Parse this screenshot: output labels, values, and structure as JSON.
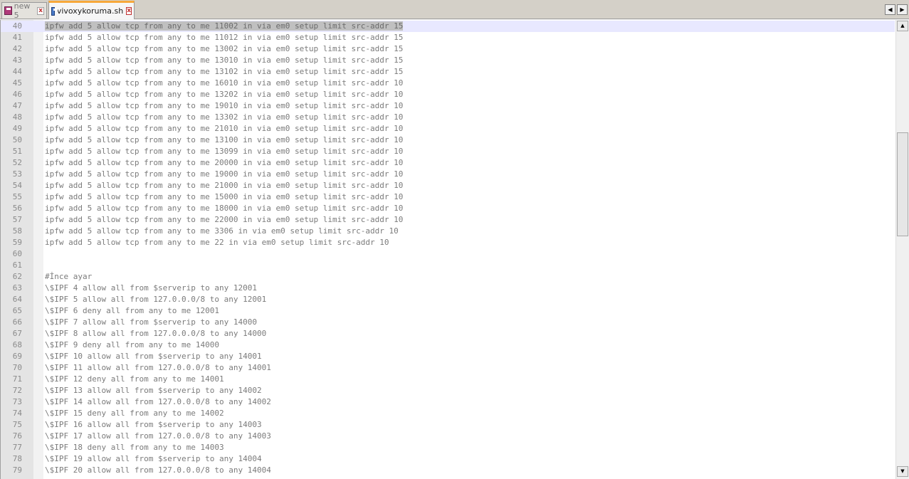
{
  "tabs": [
    {
      "label": "new 5",
      "state": "inactive",
      "icon": "unsaved-file-icon"
    },
    {
      "label": "vivoxykoruma.sh",
      "state": "active",
      "icon": "saved-file-icon"
    }
  ],
  "tab_nav": {
    "left": "◀",
    "right": "▶"
  },
  "scrollbar": {
    "up": "▲",
    "down": "▼"
  },
  "editor": {
    "current_line": 40,
    "lines": [
      {
        "n": "40",
        "text": "ipfw add 5 allow tcp from any to me 11002 in via em0 setup limit src-addr 15"
      },
      {
        "n": "41",
        "text": "ipfw add 5 allow tcp from any to me 11012 in via em0 setup limit src-addr 15"
      },
      {
        "n": "42",
        "text": "ipfw add 5 allow tcp from any to me 13002 in via em0 setup limit src-addr 15"
      },
      {
        "n": "43",
        "text": "ipfw add 5 allow tcp from any to me 13010 in via em0 setup limit src-addr 15"
      },
      {
        "n": "44",
        "text": "ipfw add 5 allow tcp from any to me 13102 in via em0 setup limit src-addr 15"
      },
      {
        "n": "45",
        "text": "ipfw add 5 allow tcp from any to me 16010 in via em0 setup limit src-addr 10"
      },
      {
        "n": "46",
        "text": "ipfw add 5 allow tcp from any to me 13202 in via em0 setup limit src-addr 10"
      },
      {
        "n": "47",
        "text": "ipfw add 5 allow tcp from any to me 19010 in via em0 setup limit src-addr 10"
      },
      {
        "n": "48",
        "text": "ipfw add 5 allow tcp from any to me 13302 in via em0 setup limit src-addr 10"
      },
      {
        "n": "49",
        "text": "ipfw add 5 allow tcp from any to me 21010 in via em0 setup limit src-addr 10"
      },
      {
        "n": "50",
        "text": "ipfw add 5 allow tcp from any to me 13100 in via em0 setup limit src-addr 10"
      },
      {
        "n": "51",
        "text": "ipfw add 5 allow tcp from any to me 13099 in via em0 setup limit src-addr 10"
      },
      {
        "n": "52",
        "text": "ipfw add 5 allow tcp from any to me 20000 in via em0 setup limit src-addr 10"
      },
      {
        "n": "53",
        "text": "ipfw add 5 allow tcp from any to me 19000 in via em0 setup limit src-addr 10"
      },
      {
        "n": "54",
        "text": "ipfw add 5 allow tcp from any to me 21000 in via em0 setup limit src-addr 10"
      },
      {
        "n": "55",
        "text": "ipfw add 5 allow tcp from any to me 15000 in via em0 setup limit src-addr 10"
      },
      {
        "n": "56",
        "text": "ipfw add 5 allow tcp from any to me 18000 in via em0 setup limit src-addr 10"
      },
      {
        "n": "57",
        "text": "ipfw add 5 allow tcp from any to me 22000 in via em0 setup limit src-addr 10"
      },
      {
        "n": "58",
        "text": "ipfw add 5 allow tcp from any to me 3306 in via em0 setup limit src-addr 10"
      },
      {
        "n": "59",
        "text": "ipfw add 5 allow tcp from any to me 22 in via em0 setup limit src-addr 10"
      },
      {
        "n": "60",
        "text": ""
      },
      {
        "n": "61",
        "text": ""
      },
      {
        "n": "62",
        "text": "#İnce ayar"
      },
      {
        "n": "63",
        "text": "\\$IPF 4 allow all from $serverip to any 12001"
      },
      {
        "n": "64",
        "text": "\\$IPF 5 allow all from 127.0.0.0/8 to any 12001"
      },
      {
        "n": "65",
        "text": "\\$IPF 6 deny all from any to me 12001"
      },
      {
        "n": "66",
        "text": "\\$IPF 7 allow all from $serverip to any 14000"
      },
      {
        "n": "67",
        "text": "\\$IPF 8 allow all from 127.0.0.0/8 to any 14000"
      },
      {
        "n": "68",
        "text": "\\$IPF 9 deny all from any to me 14000"
      },
      {
        "n": "69",
        "text": "\\$IPF 10 allow all from $serverip to any 14001"
      },
      {
        "n": "70",
        "text": "\\$IPF 11 allow all from 127.0.0.0/8 to any 14001"
      },
      {
        "n": "71",
        "text": "\\$IPF 12 deny all from any to me 14001"
      },
      {
        "n": "72",
        "text": "\\$IPF 13 allow all from $serverip to any 14002"
      },
      {
        "n": "73",
        "text": "\\$IPF 14 allow all from 127.0.0.0/8 to any 14002"
      },
      {
        "n": "74",
        "text": "\\$IPF 15 deny all from any to me 14002"
      },
      {
        "n": "75",
        "text": "\\$IPF 16 allow all from $serverip to any 14003"
      },
      {
        "n": "76",
        "text": "\\$IPF 17 allow all from 127.0.0.0/8 to any 14003"
      },
      {
        "n": "77",
        "text": "\\$IPF 18 deny all from any to me 14003"
      },
      {
        "n": "78",
        "text": "\\$IPF 19 allow all from $serverip to any 14004"
      },
      {
        "n": "79",
        "text": "\\$IPF 20 allow all from 127.0.0.0/8 to any 14004"
      }
    ]
  }
}
